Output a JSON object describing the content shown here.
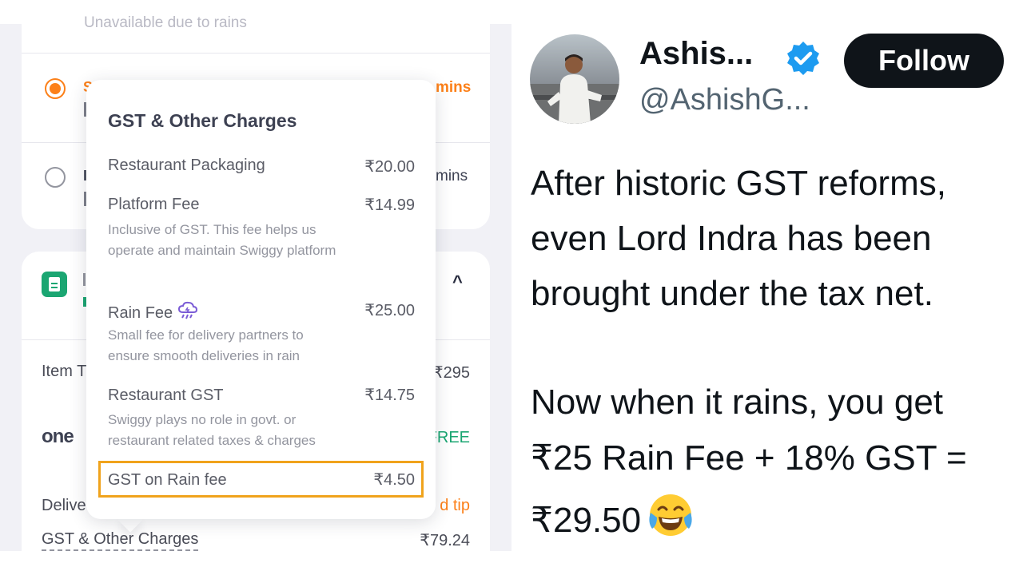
{
  "left": {
    "faded_top_text": "Unavailable due to rains",
    "option1": {
      "letter": "S",
      "mins": "mins"
    },
    "option2": {
      "letter": "I",
      "mins": "mins"
    },
    "bill_rows": {
      "item_total": {
        "label": "Item T",
        "value": "₹295"
      },
      "one": {
        "label": "one",
        "value": "FREE"
      },
      "delivery": {
        "label": "Delive",
        "value": "d tip"
      },
      "gst": {
        "label": "GST & Other Charges",
        "value": "₹79.24"
      }
    },
    "popup": {
      "title": "GST & Other Charges",
      "items": [
        {
          "label": "Restaurant Packaging",
          "price": "₹20.00",
          "desc": ""
        },
        {
          "label": "Platform Fee",
          "price": "₹14.99",
          "desc": "Inclusive of GST. This fee helps us operate and maintain Swiggy platform"
        },
        {
          "label": "Rain Fee",
          "price": "₹25.00",
          "desc": "Small fee for delivery partners to ensure smooth deliveries in rain"
        },
        {
          "label": "Restaurant GST",
          "price": "₹14.75",
          "desc": "Swiggy plays no role in govt. or restaurant related taxes & charges"
        },
        {
          "label": "GST on Rain fee",
          "price": "₹4.50",
          "desc": ""
        }
      ]
    },
    "colors": {
      "accent": "#fc8019",
      "green": "#1ba672",
      "highlight": "#f0a31c"
    }
  },
  "tweet": {
    "name": "Ashis...",
    "handle": "@AshishG...",
    "follow_label": "Follow",
    "lines": [
      "After historic GST reforms,",
      "even Lord Indra has been",
      "brought under the tax net.",
      "Now when it rains, you get",
      "₹25 Rain Fee + 18% GST =",
      "₹29.50"
    ],
    "emoji": "face-with-tears-of-joy",
    "verified_color": "#1d9bf0"
  }
}
